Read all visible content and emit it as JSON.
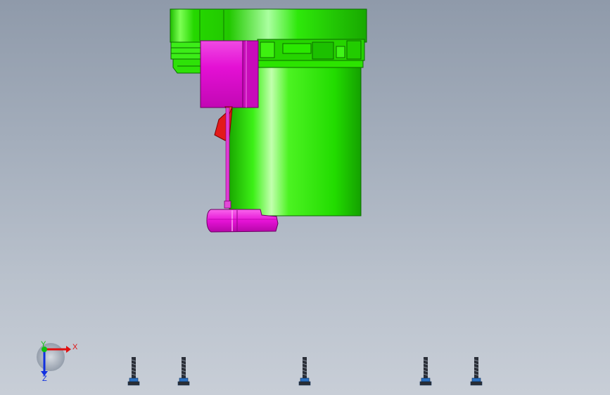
{
  "viewport": {
    "background_top": "#8f9aaa",
    "background_bottom": "#c8ced7"
  },
  "model": {
    "housing_color": "#22e000",
    "housing_highlight": "#b6ff9c",
    "block_color": "#e80fd6",
    "block_shadow": "#a2069a",
    "wedge_color": "#e01a1a"
  },
  "triad": {
    "x_label": "X",
    "y_label": "Y",
    "z_label": "Z",
    "x_color": "#e01010",
    "y_color": "#10c010",
    "z_color": "#1030e0"
  },
  "fasteners": {
    "count": 5,
    "color": "#2b2f38",
    "washer_color": "#2a6fc0"
  }
}
